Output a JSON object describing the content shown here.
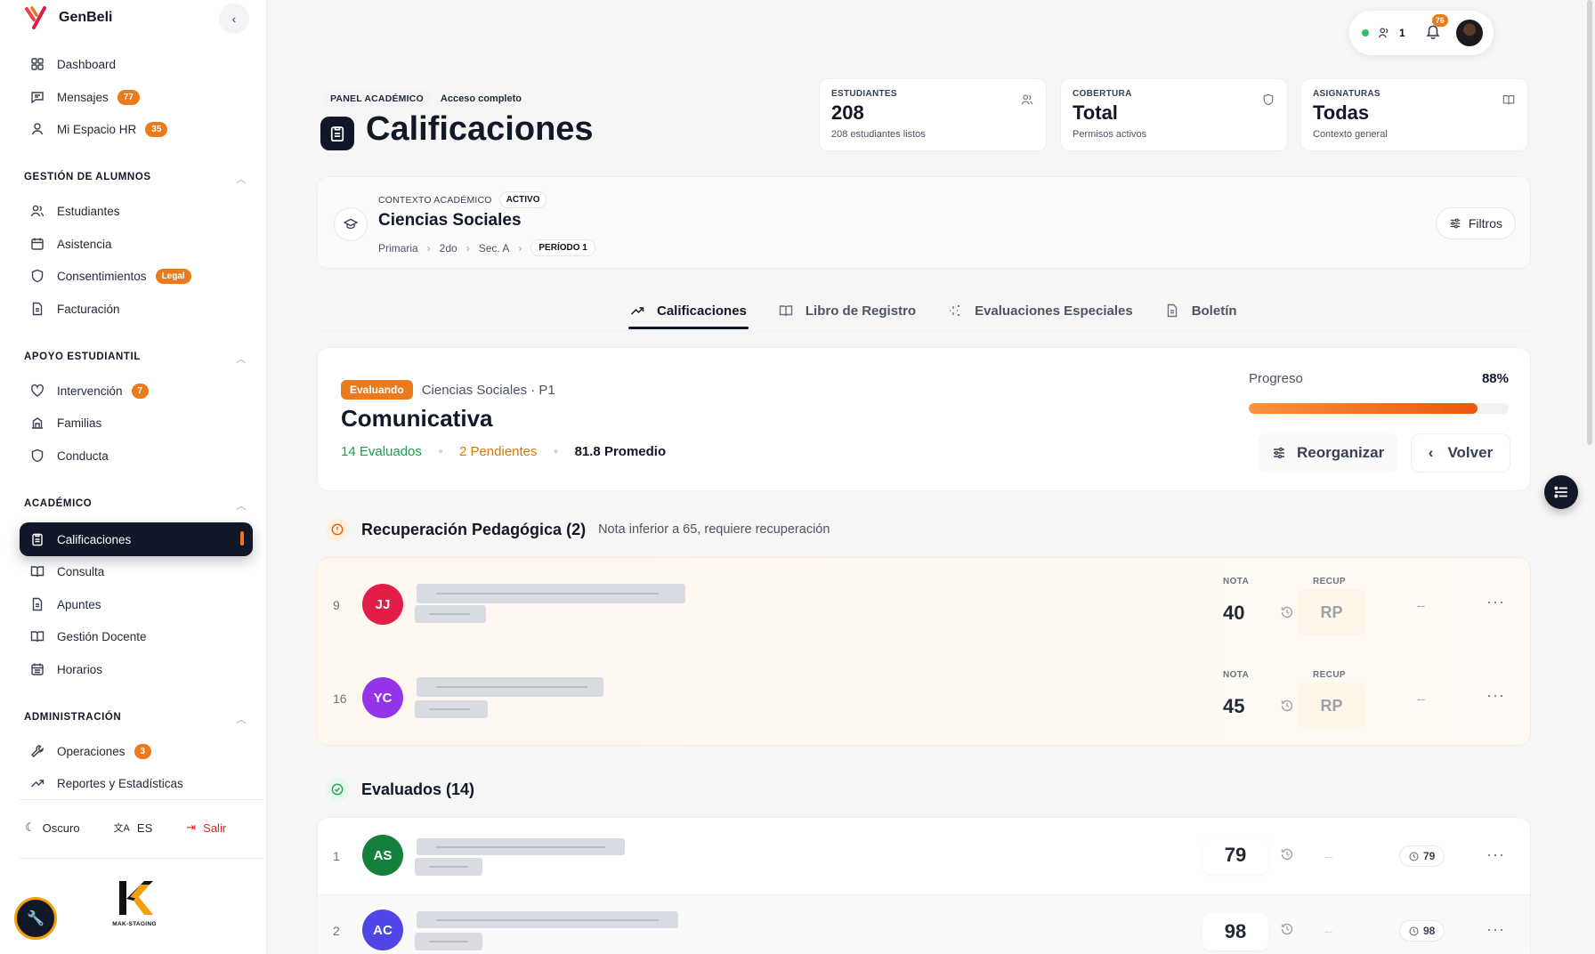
{
  "brand": {
    "name": "GenBeli"
  },
  "sidebar": {
    "top_items": [
      {
        "label": "Dashboard"
      },
      {
        "label": "Mensajes",
        "badge": "77"
      },
      {
        "label": "Mi Espacio HR",
        "badge": "35"
      }
    ],
    "sections": [
      {
        "title": "GESTIÓN DE ALUMNOS",
        "items": [
          {
            "label": "Estudiantes"
          },
          {
            "label": "Asistencia"
          },
          {
            "label": "Consentimientos",
            "badge": "Legal"
          },
          {
            "label": "Facturación"
          }
        ]
      },
      {
        "title": "APOYO ESTUDIANTIL",
        "items": [
          {
            "label": "Intervención",
            "badge": "7"
          },
          {
            "label": "Familias"
          },
          {
            "label": "Conducta"
          }
        ]
      },
      {
        "title": "ACADÉMICO",
        "items": [
          {
            "label": "Calificaciones",
            "active": true
          },
          {
            "label": "Consulta"
          },
          {
            "label": "Apuntes"
          },
          {
            "label": "Gestión Docente"
          },
          {
            "label": "Horarios"
          }
        ]
      },
      {
        "title": "ADMINISTRACIÓN",
        "items": [
          {
            "label": "Operaciones",
            "badge": "3"
          },
          {
            "label": "Reportes y Estadísticas"
          }
        ]
      }
    ],
    "bottom": {
      "theme": "Oscuro",
      "lang": "ES",
      "logout": "Salir"
    },
    "partner_logo_text": "MAK-STAGING"
  },
  "topbar": {
    "online_count": "1",
    "notifications": "76"
  },
  "header": {
    "tag": "PANEL ACADÉMICO",
    "access": "Acceso completo",
    "title": "Calificaciones"
  },
  "stats": [
    {
      "label": "ESTUDIANTES",
      "value": "208",
      "sub": "208 estudiantes listos",
      "icon": "users-icon"
    },
    {
      "label": "COBERTURA",
      "value": "Total",
      "sub": "Permisos activos",
      "icon": "shield-icon"
    },
    {
      "label": "ASIGNATURAS",
      "value": "Todas",
      "sub": "Contexto general",
      "icon": "book-icon"
    }
  ],
  "context": {
    "label": "CONTEXTO ACADÉMICO",
    "status": "ACTIVO",
    "subject": "Ciencias Sociales",
    "crumbs": [
      "Primaria",
      "2do",
      "Sec. A"
    ],
    "period": "PERÍODO 1",
    "filters": "Filtros"
  },
  "tabs": [
    {
      "label": "Calificaciones",
      "active": true
    },
    {
      "label": "Libro de Registro"
    },
    {
      "label": "Evaluaciones Especiales"
    },
    {
      "label": "Boletín"
    }
  ],
  "evaluation": {
    "status": "Evaluando",
    "context": "Ciencias Sociales · P1",
    "name": "Comunicativa",
    "evaluated": "14 Evaluados",
    "pending": "2 Pendientes",
    "average": "81.8 Promedio",
    "progress_label": "Progreso",
    "progress_text": "88%",
    "progress": 0.88,
    "reorganize": "Reorganizar",
    "back": "Volver"
  },
  "recovery": {
    "title": "Recuperación Pedagógica (2)",
    "desc": "Nota inferior a 65, requiere recuperación",
    "col_grade": "NOTA",
    "col_recup": "RECUP",
    "rows": [
      {
        "num": "9",
        "initials": "JJ",
        "color": "#e11d48",
        "grade": "40",
        "recup": "RP",
        "extra": "--"
      },
      {
        "num": "16",
        "initials": "YC",
        "color": "#9333ea",
        "grade": "45",
        "recup": "RP",
        "extra": "--"
      }
    ]
  },
  "evaluated": {
    "title": "Evaluados (14)",
    "rows": [
      {
        "num": "1",
        "initials": "AS",
        "color": "#15803d",
        "grade": "79",
        "recup": "--",
        "pill": "79"
      },
      {
        "num": "2",
        "initials": "AC",
        "color": "#4f46e5",
        "grade": "98",
        "recup": "--",
        "pill": "98"
      }
    ]
  }
}
